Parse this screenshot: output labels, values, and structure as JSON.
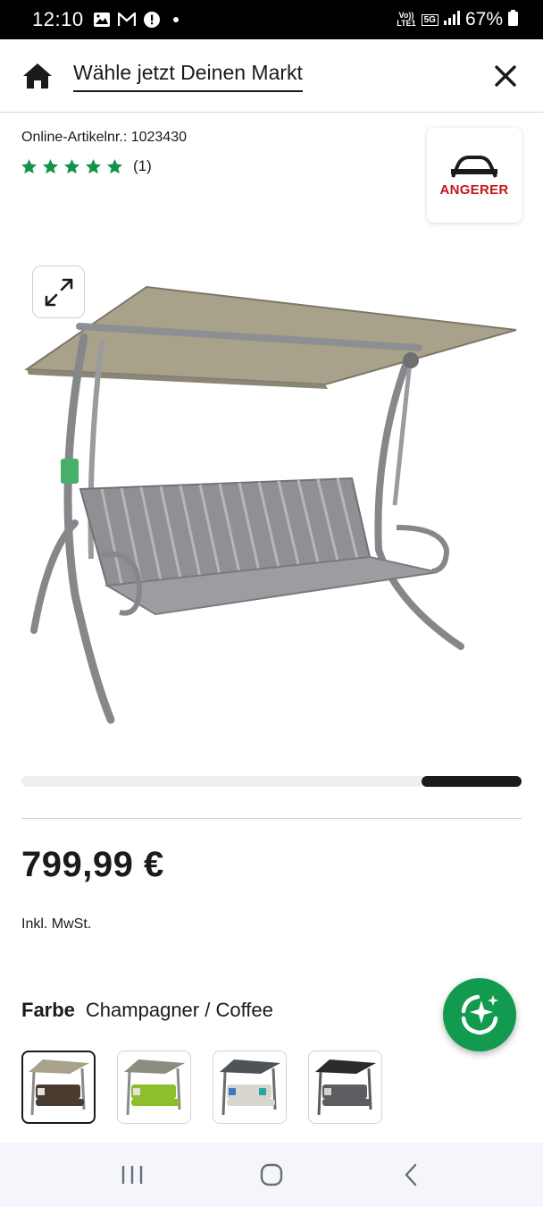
{
  "status_bar": {
    "time": "12:10",
    "network_top": "Vo))",
    "network_bottom": "LTE1",
    "network_type": "5G",
    "battery": "67%"
  },
  "header": {
    "market_select": "Wähle jetzt Deinen Markt",
    "home_icon": "home-icon",
    "close_icon": "close-icon"
  },
  "product": {
    "article_number": "Online-Artikelnr.: 1023430",
    "rating_stars": 5,
    "rating_count": "(1)",
    "brand": "ANGERER",
    "gallery_progress": 0.2,
    "price": "799,99 €",
    "vat_note": "Inkl. MwSt.",
    "color_label": "Farbe",
    "color_value": "Champagner / Coffee",
    "swatches": [
      {
        "cushion": "#4a3b30",
        "selected": true
      },
      {
        "cushion": "#8cbf2a",
        "selected": false
      },
      {
        "cushion": "#d9d6cf",
        "selected": false
      },
      {
        "cushion": "#5b5d60",
        "selected": false
      }
    ]
  },
  "colors": {
    "accent_green": "#129b4f",
    "star_green": "#12934c",
    "brand_red": "#c4161c"
  }
}
